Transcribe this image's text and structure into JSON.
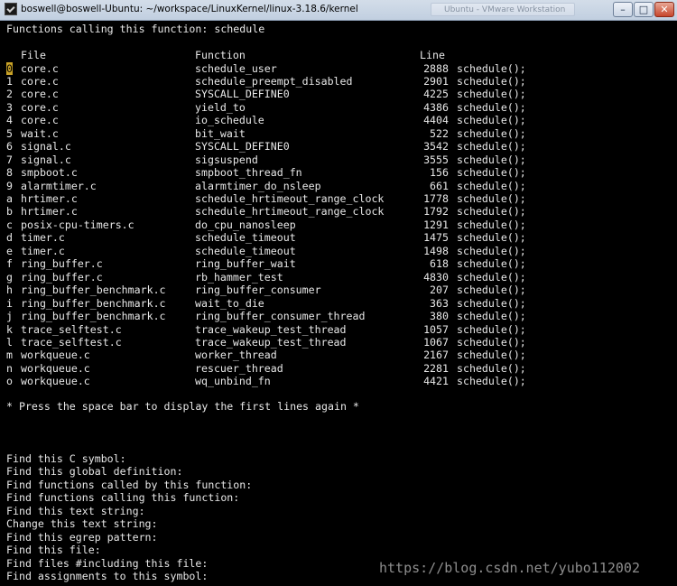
{
  "window": {
    "title": "boswell@boswell-Ubuntu: ~/workspace/LinuxKernel/linux-3.18.6/kernel",
    "background_app": "Ubuntu - VMware Workstation",
    "minimize": "–",
    "maximize": "□",
    "close": "✕"
  },
  "terminal": {
    "heading": "Functions calling this function: schedule",
    "columns": {
      "file": "File",
      "function": "Function",
      "line": "Line"
    },
    "results": [
      {
        "key": "0",
        "file": "core.c",
        "function": "schedule_user",
        "line": "2888",
        "code": "schedule();"
      },
      {
        "key": "1",
        "file": "core.c",
        "function": "schedule_preempt_disabled",
        "line": "2901",
        "code": "schedule();"
      },
      {
        "key": "2",
        "file": "core.c",
        "function": "SYSCALL_DEFINE0",
        "line": "4225",
        "code": "schedule();"
      },
      {
        "key": "3",
        "file": "core.c",
        "function": "yield_to",
        "line": "4386",
        "code": "schedule();"
      },
      {
        "key": "4",
        "file": "core.c",
        "function": "io_schedule",
        "line": "4404",
        "code": "schedule();"
      },
      {
        "key": "5",
        "file": "wait.c",
        "function": "bit_wait",
        "line": "522",
        "code": "schedule();"
      },
      {
        "key": "6",
        "file": "signal.c",
        "function": "SYSCALL_DEFINE0",
        "line": "3542",
        "code": "schedule();"
      },
      {
        "key": "7",
        "file": "signal.c",
        "function": "sigsuspend",
        "line": "3555",
        "code": "schedule();"
      },
      {
        "key": "8",
        "file": "smpboot.c",
        "function": "smpboot_thread_fn",
        "line": "156",
        "code": "schedule();"
      },
      {
        "key": "9",
        "file": "alarmtimer.c",
        "function": "alarmtimer_do_nsleep",
        "line": "661",
        "code": "schedule();"
      },
      {
        "key": "a",
        "file": "hrtimer.c",
        "function": "schedule_hrtimeout_range_clock",
        "line": "1778",
        "code": "schedule();"
      },
      {
        "key": "b",
        "file": "hrtimer.c",
        "function": "schedule_hrtimeout_range_clock",
        "line": "1792",
        "code": "schedule();"
      },
      {
        "key": "c",
        "file": "posix-cpu-timers.c",
        "function": "do_cpu_nanosleep",
        "line": "1291",
        "code": "schedule();"
      },
      {
        "key": "d",
        "file": "timer.c",
        "function": "schedule_timeout",
        "line": "1475",
        "code": "schedule();"
      },
      {
        "key": "e",
        "file": "timer.c",
        "function": "schedule_timeout",
        "line": "1498",
        "code": "schedule();"
      },
      {
        "key": "f",
        "file": "ring_buffer.c",
        "function": "ring_buffer_wait",
        "line": "618",
        "code": "schedule();"
      },
      {
        "key": "g",
        "file": "ring_buffer.c",
        "function": "rb_hammer_test",
        "line": "4830",
        "code": "schedule();"
      },
      {
        "key": "h",
        "file": "ring_buffer_benchmark.c",
        "function": "ring_buffer_consumer",
        "line": "207",
        "code": "schedule();"
      },
      {
        "key": "i",
        "file": "ring_buffer_benchmark.c",
        "function": "wait_to_die",
        "line": "363",
        "code": "schedule();"
      },
      {
        "key": "j",
        "file": "ring_buffer_benchmark.c",
        "function": "ring_buffer_consumer_thread",
        "line": "380",
        "code": "schedule();"
      },
      {
        "key": "k",
        "file": "trace_selftest.c",
        "function": "trace_wakeup_test_thread",
        "line": "1057",
        "code": "schedule();"
      },
      {
        "key": "l",
        "file": "trace_selftest.c",
        "function": "trace_wakeup_test_thread",
        "line": "1067",
        "code": "schedule();"
      },
      {
        "key": "m",
        "file": "workqueue.c",
        "function": "worker_thread",
        "line": "2167",
        "code": "schedule();"
      },
      {
        "key": "n",
        "file": "workqueue.c",
        "function": "rescuer_thread",
        "line": "2281",
        "code": "schedule();"
      },
      {
        "key": "o",
        "file": "workqueue.c",
        "function": "wq_unbind_fn",
        "line": "4421",
        "code": "schedule();"
      }
    ],
    "footer_message": "* Press the space bar to display the first lines again *",
    "menu": [
      "Find this C symbol:",
      "Find this global definition:",
      "Find functions called by this function:",
      "Find functions calling this function:",
      "Find this text string:",
      "Change this text string:",
      "Find this egrep pattern:",
      "Find this file:",
      "Find files #including this file:",
      "Find assignments to this symbol:"
    ]
  },
  "watermark": "https://blog.csdn.net/yubo112002",
  "colors": {
    "terminal_bg": "#000000",
    "terminal_fg": "#e8e8e8",
    "cursor": "#c9a227"
  }
}
